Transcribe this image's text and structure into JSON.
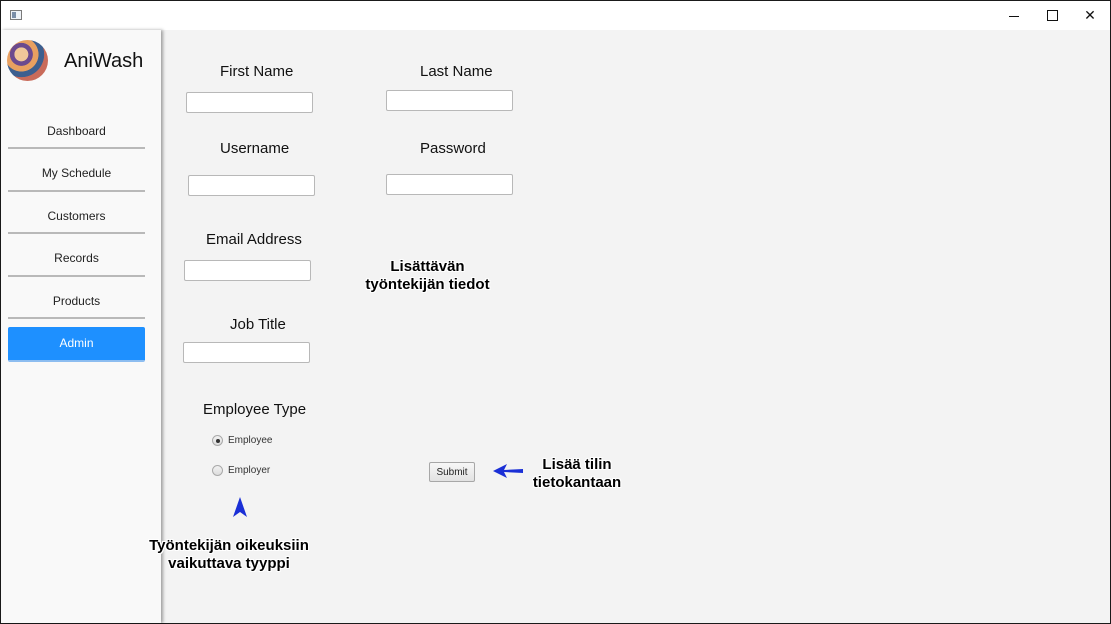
{
  "window": {
    "minimize_glyph": "minimize-icon",
    "maximize_glyph": "maximize-icon",
    "close_glyph": "✕"
  },
  "app": {
    "name": "AniWash"
  },
  "sidebar": {
    "items": [
      {
        "label": "Dashboard",
        "active": false
      },
      {
        "label": "My Schedule",
        "active": false
      },
      {
        "label": "Customers",
        "active": false
      },
      {
        "label": "Records",
        "active": false
      },
      {
        "label": "Products",
        "active": false
      },
      {
        "label": "Admin",
        "active": true
      }
    ]
  },
  "form": {
    "first_name": {
      "label": "First Name",
      "value": ""
    },
    "last_name": {
      "label": "Last Name",
      "value": ""
    },
    "username": {
      "label": "Username",
      "value": ""
    },
    "password": {
      "label": "Password",
      "value": ""
    },
    "email": {
      "label": "Email Address",
      "value": ""
    },
    "job_title": {
      "label": "Job Title",
      "value": ""
    },
    "employee_type": {
      "label": "Employee Type",
      "options": [
        {
          "label": "Employee",
          "selected": true
        },
        {
          "label": "Employer",
          "selected": false
        }
      ]
    },
    "submit_label": "Submit"
  },
  "annotations": {
    "fields_note": [
      "Lisättävän",
      "työntekijän tiedot"
    ],
    "submit_note": [
      "Lisää tilin",
      "tietokantaan"
    ],
    "type_note": [
      "Työntekijän oikeuksiin",
      "vaikuttava tyyppi"
    ],
    "arrow_color": "#1a2fd6"
  },
  "colors": {
    "accent": "#1e90ff"
  }
}
